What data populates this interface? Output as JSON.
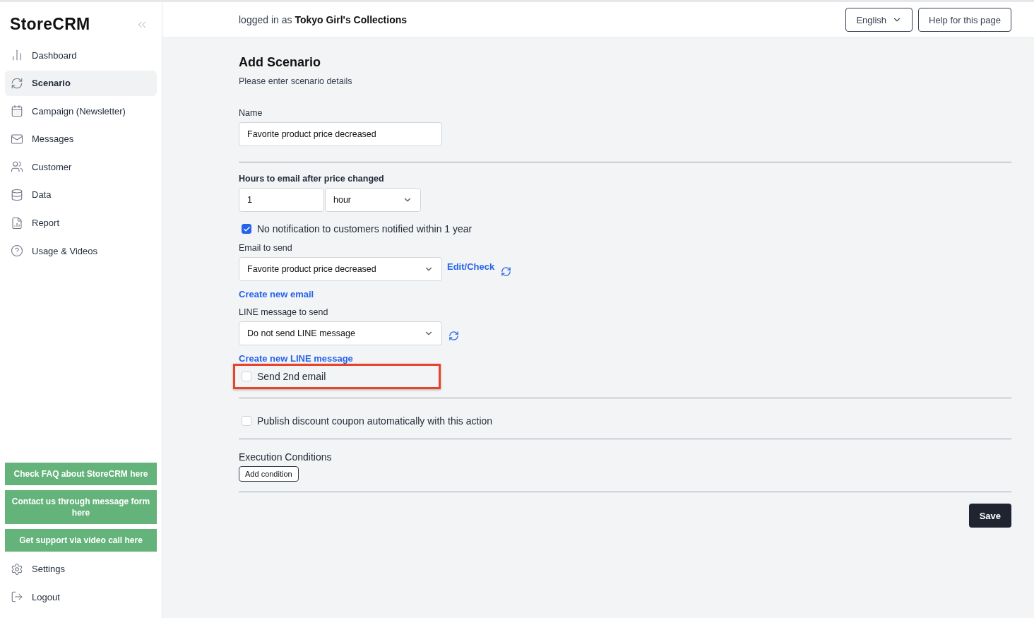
{
  "sidebar": {
    "logo": "StoreCRM",
    "items": [
      {
        "label": "Dashboard",
        "selected": false
      },
      {
        "label": "Scenario",
        "selected": true
      },
      {
        "label": "Campaign (Newsletter)",
        "selected": false
      },
      {
        "label": "Messages",
        "selected": false
      },
      {
        "label": "Customer",
        "selected": false
      },
      {
        "label": "Data",
        "selected": false
      },
      {
        "label": "Report",
        "selected": false
      },
      {
        "label": "Usage & Videos",
        "selected": false
      }
    ],
    "support_buttons": [
      "Check FAQ about StoreCRM here",
      "Contact us through message form here",
      "Get support via video call here"
    ],
    "bottom_items": [
      {
        "label": "Settings"
      },
      {
        "label": "Logout"
      }
    ]
  },
  "header": {
    "logged_in_prefix": "logged in as",
    "store": "Tokyo Girl's Collections",
    "language": "English",
    "help": "Help for this page"
  },
  "form": {
    "title": "Add Scenario",
    "subtitle": "Please enter scenario details",
    "name": {
      "label": "Name",
      "value": "Favorite product price decreased"
    },
    "hours": {
      "label": "Hours to email after price changed",
      "value": "1",
      "unit": "hour"
    },
    "no_notification": {
      "label": "No notification to customers notified within 1 year",
      "checked": true
    },
    "email": {
      "label": "Email to send",
      "value": "Favorite product price decreased",
      "edit_link": "Edit/Check",
      "create_link": "Create new email"
    },
    "line": {
      "label": "LINE message to send",
      "value": "Do not send LINE message",
      "create_link": "Create new LINE message"
    },
    "second_email": {
      "label": "Send 2nd email",
      "checked": false,
      "highlighted": true
    },
    "coupon": {
      "label": "Publish discount coupon automatically with this action",
      "checked": false
    },
    "conditions": {
      "title": "Execution Conditions",
      "button": "Add condition"
    },
    "save": "Save"
  }
}
